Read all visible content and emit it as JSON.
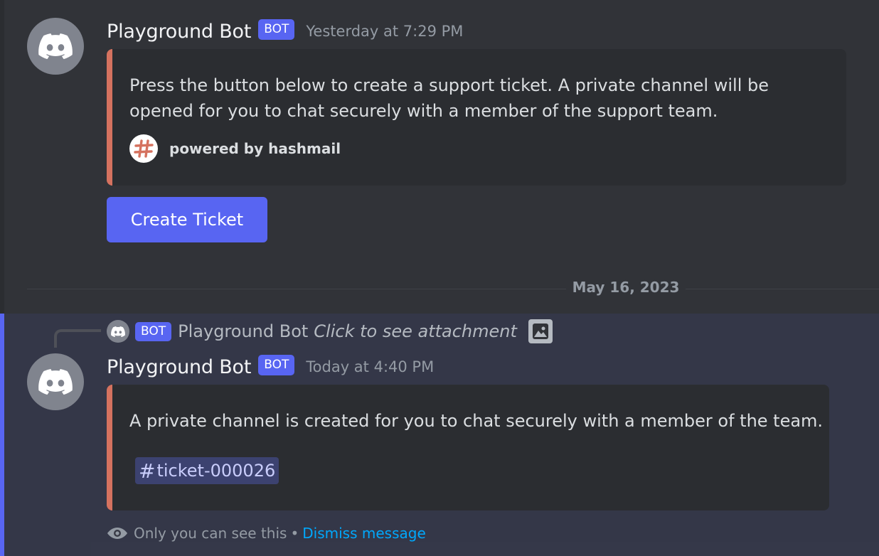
{
  "message1": {
    "author": "Playground Bot",
    "tag": "BOT",
    "timestamp": "Yesterday at 7:29 PM",
    "embed": {
      "description_line1": "Press the button below to create a support ticket. A private channel will be",
      "description_line2": "opened for you to chat securely with a member of the support team.",
      "footer_text": "powered by hashmail",
      "accent_color": "#d5725f"
    },
    "button_label": "Create Ticket"
  },
  "divider": {
    "date": "May 16, 2023"
  },
  "message2": {
    "reply": {
      "tag": "BOT",
      "author": "Playground Bot",
      "text": "Click to see attachment"
    },
    "author": "Playground Bot",
    "tag": "BOT",
    "timestamp": "Today at 4:40 PM",
    "embed": {
      "description": "A private channel is created for you to chat securely with a member of the team.",
      "channel_mention": "ticket-000026",
      "channel_hash": "#"
    },
    "notice": {
      "text": "Only you can see this",
      "separator": "•",
      "dismiss_label": "Dismiss message"
    }
  },
  "colors": {
    "blurple": "#5865f2",
    "background": "#313338",
    "embed_background": "#2b2d31",
    "link": "#00a8fc"
  },
  "icons": {
    "avatar": "discord-logo-icon",
    "footer": "hashmail-logo-icon",
    "attachment": "image-icon",
    "notice": "eye-icon"
  }
}
